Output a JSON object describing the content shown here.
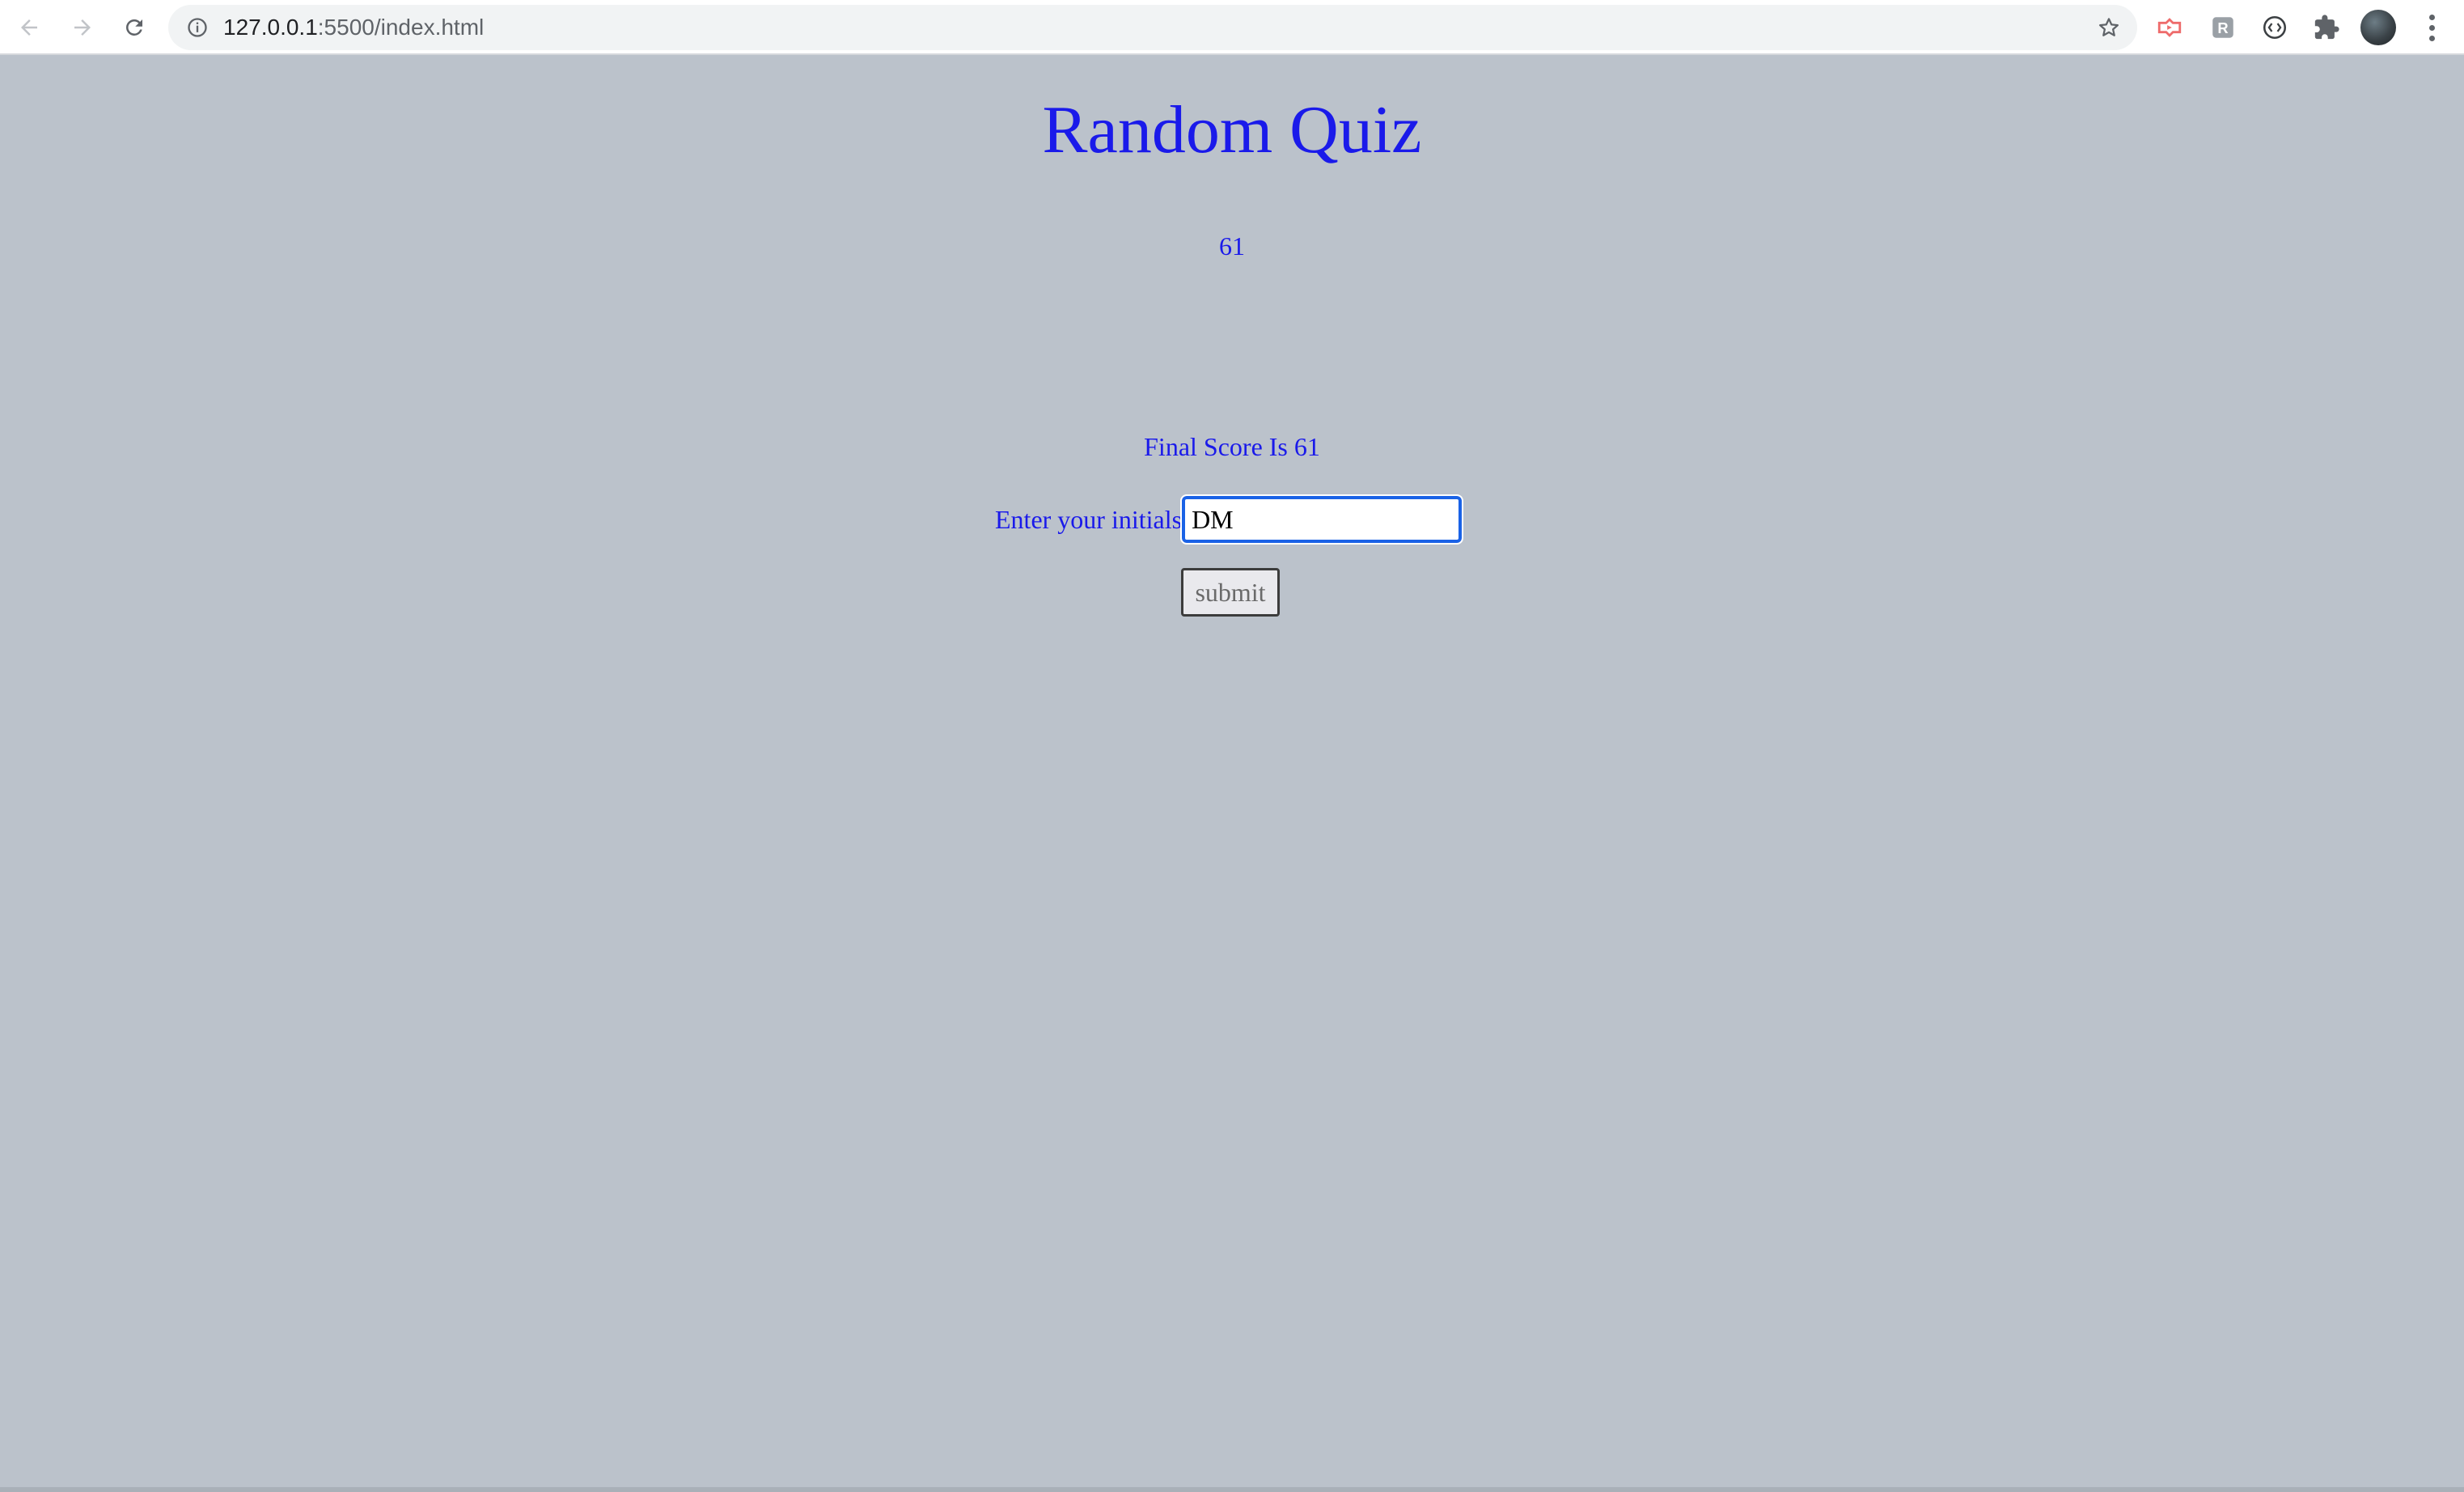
{
  "browser": {
    "url_host": "127.0.0.1",
    "url_rest": ":5500/index.html",
    "icons": {
      "back": "back-arrow-icon",
      "forward": "forward-arrow-icon",
      "reload": "reload-icon",
      "site_info": "info-icon",
      "bookmark": "star-icon",
      "extensions": [
        "red-extension-icon",
        "gray-r-extension-icon",
        "brackets-extension-icon",
        "puzzle-icon"
      ],
      "profile": "avatar",
      "menu": "kebab-menu-icon"
    }
  },
  "page": {
    "title": "Random Quiz",
    "timer": "61",
    "final_score": "Final Score Is 61",
    "initials_label": "Enter your initials",
    "initials_value": "DM",
    "submit_label": "submit"
  },
  "colors": {
    "background": "#bbc2cb",
    "text_accent": "#1a1aea",
    "focus_ring": "#1a62e6"
  }
}
